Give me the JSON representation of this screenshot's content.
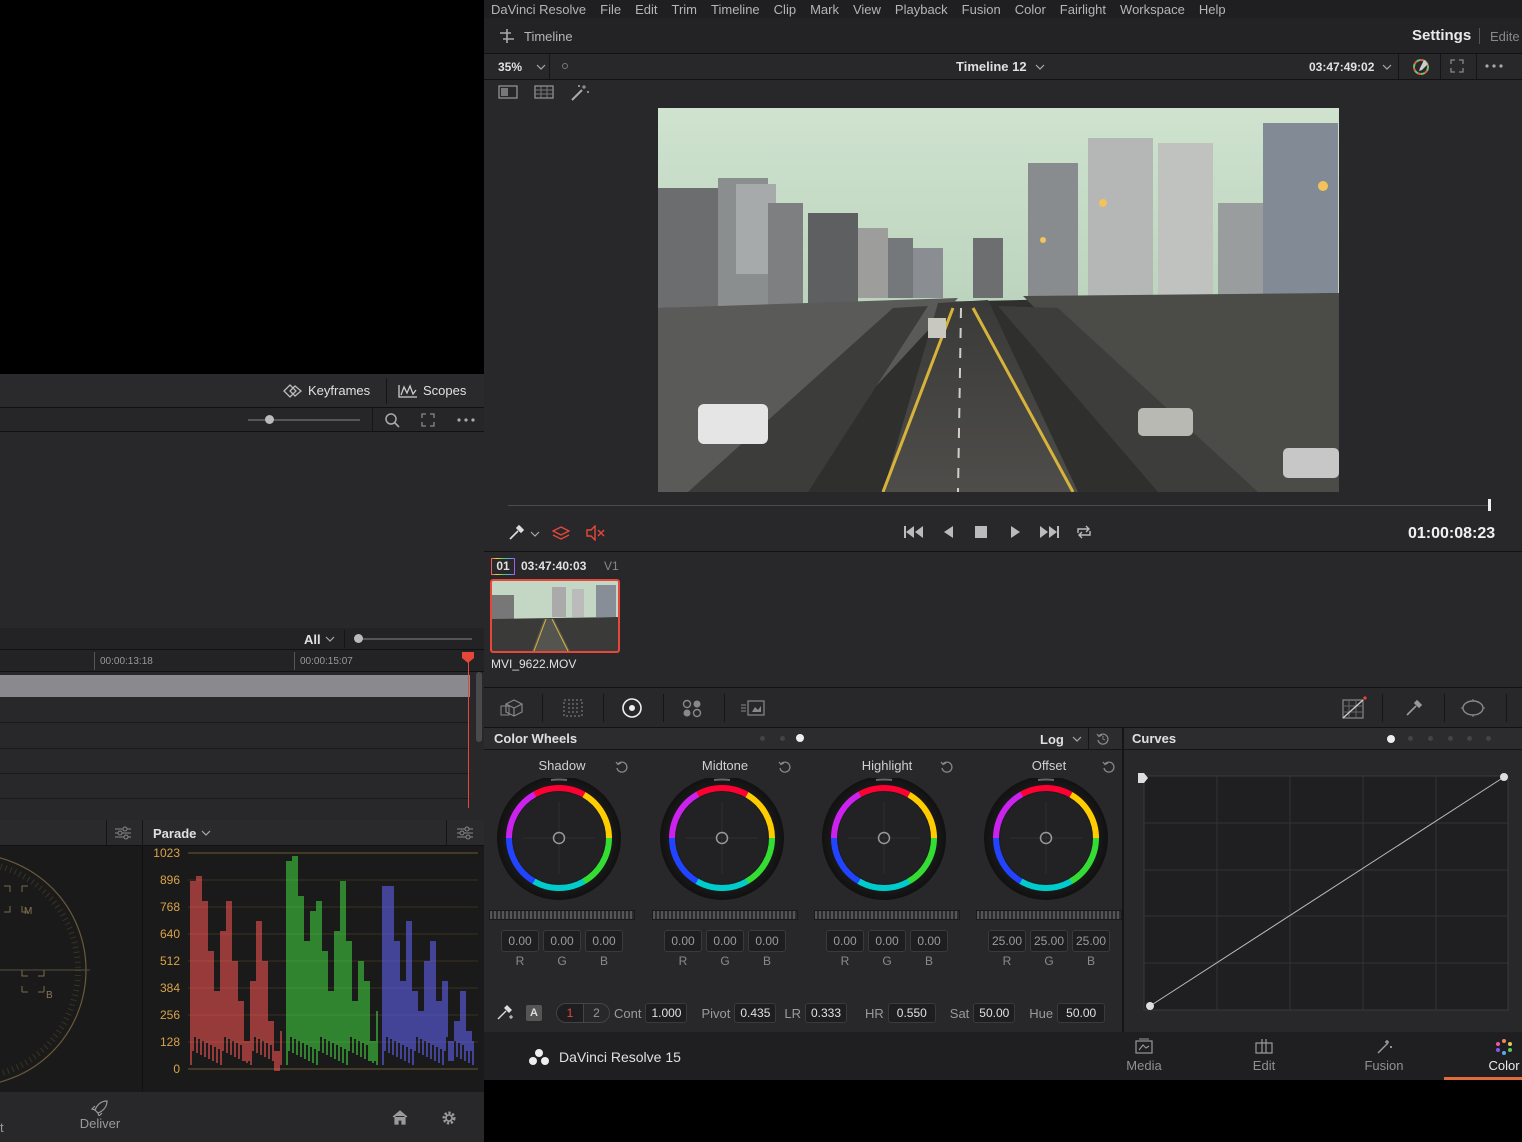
{
  "left_panel": {
    "keyframes_label": "Keyframes",
    "scopes_label": "Scopes",
    "timeline_filter": "All",
    "timecodes": [
      "00:00:13:18",
      "00:00:15:07"
    ],
    "scope_mode": "Parade",
    "parade_scale": [
      "1023",
      "896",
      "768",
      "640",
      "512",
      "384",
      "256",
      "128",
      "0"
    ],
    "vectorscope_labels": [
      "M",
      "B"
    ],
    "footer_partial": "t",
    "deliver_label": "Deliver"
  },
  "menubar": {
    "items": [
      "DaVinci Resolve",
      "File",
      "Edit",
      "Trim",
      "Timeline",
      "Clip",
      "Mark",
      "View",
      "Playback",
      "Fusion",
      "Color",
      "Fairlight",
      "Workspace",
      "Help"
    ]
  },
  "titlebar": {
    "timeline_label": "Timeline",
    "settings_label": "Settings",
    "edited_partial": "Edite"
  },
  "viewer": {
    "zoom": "35%",
    "timeline_name": "Timeline 12",
    "source_timecode": "03:47:49:02",
    "playhead_timecode": "01:00:08:23"
  },
  "clip": {
    "number": "01",
    "timecode": "03:47:40:03",
    "track": "V1",
    "name": "MVI_9622.MOV"
  },
  "color_wheels": {
    "title": "Color Wheels",
    "mode": "Log",
    "wheels": [
      {
        "label": "Shadow",
        "values": [
          "0.00",
          "0.00",
          "0.00"
        ]
      },
      {
        "label": "Midtone",
        "values": [
          "0.00",
          "0.00",
          "0.00"
        ]
      },
      {
        "label": "Highlight",
        "values": [
          "0.00",
          "0.00",
          "0.00"
        ]
      },
      {
        "label": "Offset",
        "values": [
          "25.00",
          "25.00",
          "25.00"
        ]
      }
    ],
    "channel_labels": [
      "R",
      "G",
      "B"
    ],
    "auto_label": "A",
    "page_1": "1",
    "page_2": "2",
    "params": {
      "cont_label": "Cont",
      "cont": "1.000",
      "pivot_label": "Pivot",
      "pivot": "0.435",
      "lr_label": "LR",
      "lr": "0.333",
      "hr_label": "HR",
      "hr": "0.550",
      "sat_label": "Sat",
      "sat": "50.00",
      "hue_label": "Hue",
      "hue": "50.00"
    }
  },
  "curves": {
    "title": "Curves"
  },
  "pagebar": {
    "brand": "DaVinci Resolve 15",
    "pages": [
      "Media",
      "Edit",
      "Fusion",
      "Color"
    ],
    "active": "Color"
  },
  "colors": {
    "accent_red": "#e6473a",
    "active_page": "#e26b3d"
  }
}
